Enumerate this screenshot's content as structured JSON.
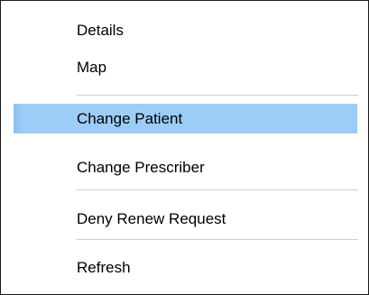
{
  "context_menu": {
    "items": [
      {
        "label": "Details"
      },
      {
        "label": "Map"
      },
      {
        "label": "Change Patient",
        "highlighted": true
      },
      {
        "label": "Change Prescriber"
      },
      {
        "label": "Deny Renew Request"
      },
      {
        "label": "Refresh"
      }
    ],
    "highlight_color": "#9ccdf6",
    "border_color": "#1a1a1a",
    "separator_color": "#cfcfcf"
  }
}
